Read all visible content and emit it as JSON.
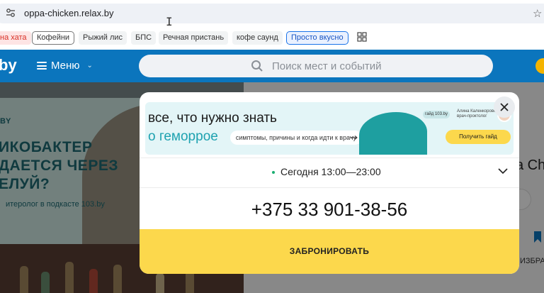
{
  "browser": {
    "url": "oppa-chicken.relax.by",
    "icons": {
      "site_info": "tune-icon",
      "bookmark_star": "star-outline-icon",
      "apps": "grid-icon"
    }
  },
  "bookmarks": [
    {
      "label": "на хата",
      "style": "red"
    },
    {
      "label": "Кофейни",
      "style": "outlined"
    },
    {
      "label": "Рыжий лис",
      "style": "plain"
    },
    {
      "label": "БПС",
      "style": "plain"
    },
    {
      "label": "Речная пристань",
      "style": "plain"
    },
    {
      "label": "кофе саунд",
      "style": "plain"
    },
    {
      "label": "Просто вкусно",
      "style": "blue"
    }
  ],
  "site_header": {
    "logo_fragment": "by",
    "menu_label": "Меню",
    "search_placeholder": "Поиск мест и событий"
  },
  "background": {
    "promo_by": "BY",
    "promo_lines": [
      "ИКОБАКТЕР",
      "ДАЕТСЯ ЧЕРЕЗ",
      "ЕЛУЙ?"
    ],
    "promo_sub": "итеролог в подкасте 103.by",
    "stripe_text": "оровье",
    "right_title": "a Chi",
    "right_favorite": "ИЗБРА"
  },
  "modal": {
    "ad": {
      "title_line1": "все, что нужно знать",
      "title_line2": "о геморрое",
      "subtitle": "симптомы, причины и когда идти к врачу",
      "badge": "гайд 103.by",
      "doctor": "Алина Каленкоровская\nврач-проктолог",
      "button": "Получить гайд"
    },
    "hours": "Сегодня 13:00—23:00",
    "phone": "+375 33 901-38-56",
    "book_button": "ЗАБРОНИРОВАТЬ",
    "accent_color": "#fcd84c",
    "open_dot_color": "#1aae72"
  }
}
